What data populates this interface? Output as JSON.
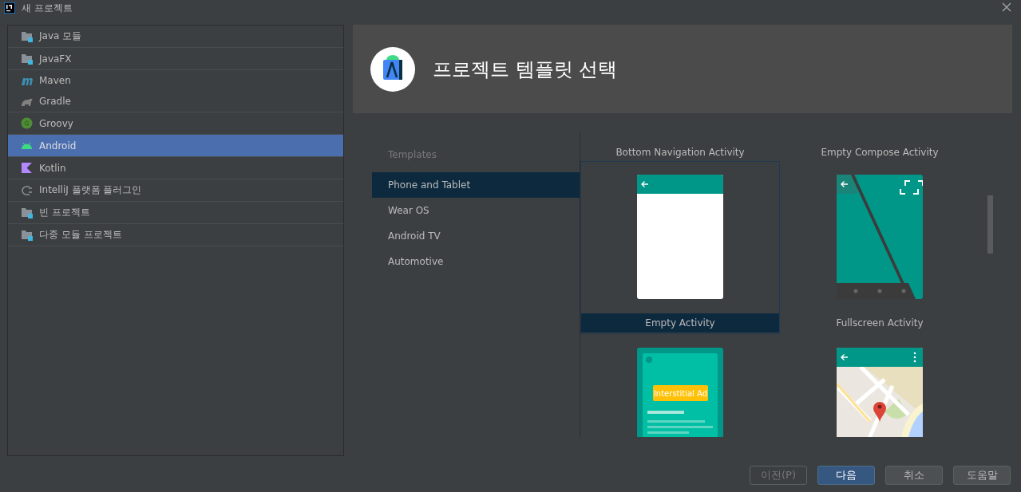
{
  "window": {
    "title": "새 프로젝트"
  },
  "sidebar": {
    "groups": [
      {
        "items": [
          {
            "label": "Java 모듈",
            "kind": "module",
            "selected": false
          }
        ]
      },
      {
        "items": [
          {
            "label": "JavaFX",
            "kind": "module",
            "selected": false
          }
        ]
      },
      {
        "items": [
          {
            "label": "Maven",
            "kind": "maven",
            "selected": false
          },
          {
            "label": "Gradle",
            "kind": "gradle",
            "selected": false
          }
        ]
      },
      {
        "items": [
          {
            "label": "Groovy",
            "kind": "groovy",
            "selected": false
          }
        ]
      },
      {
        "items": [
          {
            "label": "Android",
            "kind": "android",
            "selected": true
          }
        ]
      },
      {
        "items": [
          {
            "label": "Kotlin",
            "kind": "kotlin",
            "selected": false
          }
        ]
      },
      {
        "items": [
          {
            "label": "IntelliJ 플랫폼 플러그인",
            "kind": "plugin",
            "selected": false
          }
        ]
      },
      {
        "items": [
          {
            "label": "빈 프로젝트",
            "kind": "module",
            "selected": false
          }
        ]
      },
      {
        "items": [
          {
            "label": "다중 모듈 프로젝트",
            "kind": "module",
            "selected": false
          }
        ]
      }
    ]
  },
  "header": {
    "title": "프로젝트 템플릿 선택"
  },
  "categories": {
    "heading": "Templates",
    "items": [
      {
        "label": "Phone and Tablet",
        "selected": true
      },
      {
        "label": "Wear OS",
        "selected": false
      },
      {
        "label": "Android TV",
        "selected": false
      },
      {
        "label": "Automotive",
        "selected": false
      }
    ]
  },
  "gallery": {
    "partial_captions": [
      "Bottom Navigation Activity",
      "Empty Compose Activity"
    ],
    "templates": [
      {
        "name": "Empty Activity",
        "kind": "empty",
        "selected": true
      },
      {
        "name": "Fullscreen Activity",
        "kind": "fullscreen",
        "selected": false
      },
      {
        "kind": "interstitial",
        "ad_label": "Interstitial Ad",
        "selected": false
      },
      {
        "kind": "map",
        "selected": false
      }
    ]
  },
  "buttons": [
    {
      "label": "이전(P)",
      "disabled": true,
      "default": false
    },
    {
      "label": "다음",
      "disabled": false,
      "default": true
    },
    {
      "label": "취소",
      "disabled": false,
      "default": false
    },
    {
      "label": "도움말",
      "disabled": false,
      "default": false
    }
  ]
}
